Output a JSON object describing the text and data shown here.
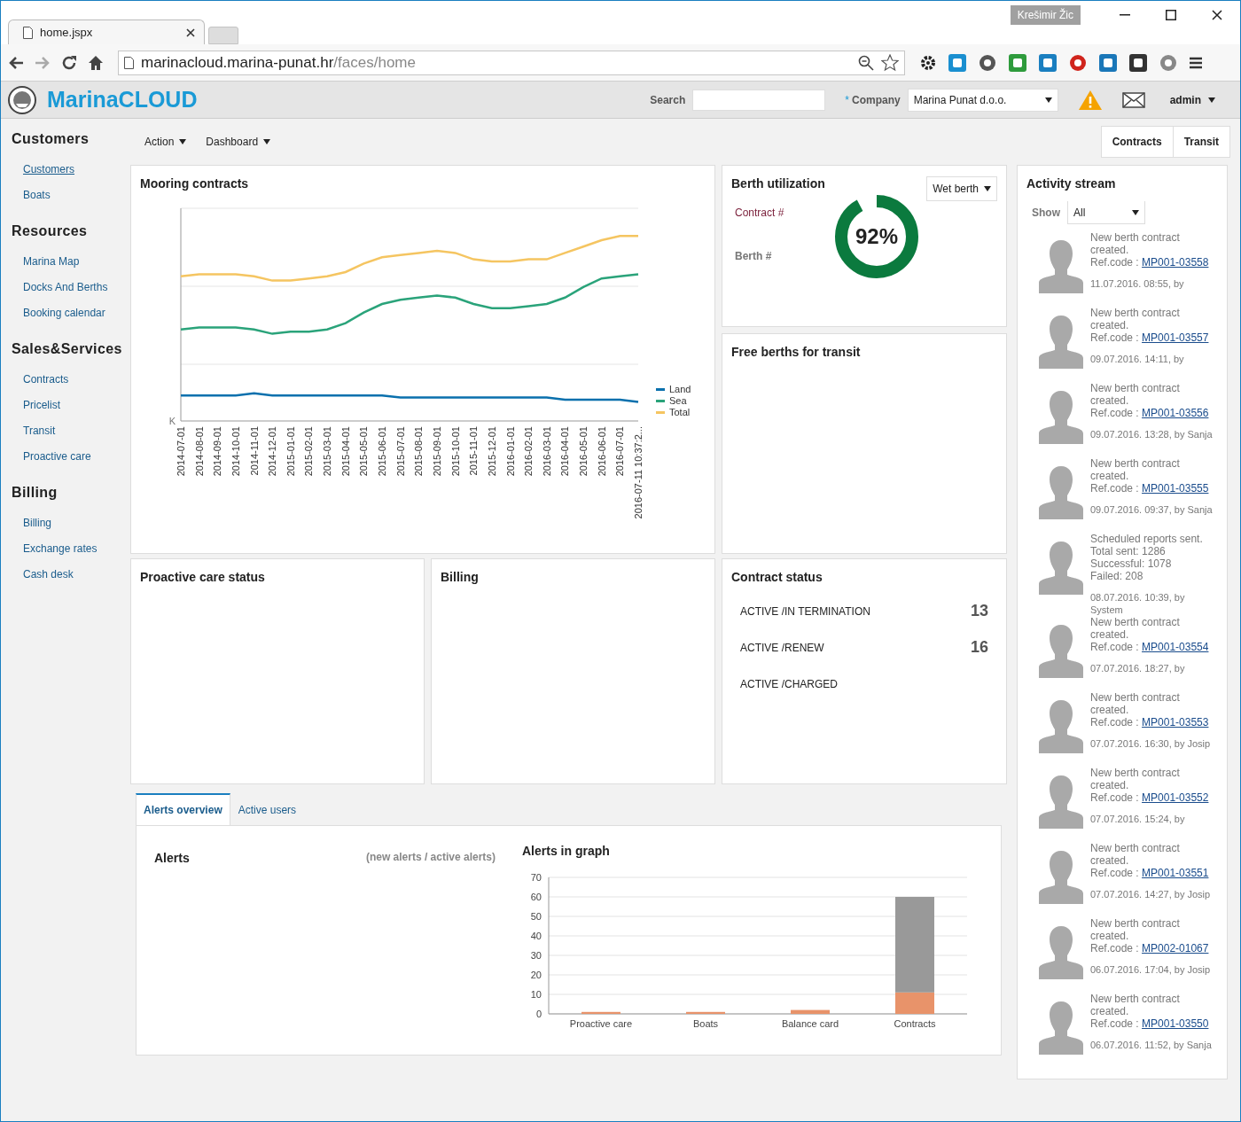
{
  "browser": {
    "tab_title": "home.jspx",
    "profile": "Krešimir Žic",
    "url_host": "marinacloud.marina-punat.hr",
    "url_path": "/faces/home"
  },
  "header": {
    "brand": "MarinaCLOUD",
    "search_label": "Search",
    "required_mark": "*",
    "company_label": "Company",
    "company_value": "Marina Punat d.o.o.",
    "user": "admin"
  },
  "toolbar": {
    "menus": [
      "Action",
      "Dashboard"
    ],
    "buttons": [
      "Contracts",
      "Transit"
    ]
  },
  "sidebar": [
    {
      "title": "Customers",
      "items": [
        {
          "label": "Customers",
          "selected": true
        },
        {
          "label": "Boats",
          "selected": false
        }
      ]
    },
    {
      "title": "Resources",
      "items": [
        {
          "label": "Marina Map",
          "selected": false
        },
        {
          "label": "Docks And Berths",
          "selected": false
        },
        {
          "label": "Booking calendar",
          "selected": false
        }
      ]
    },
    {
      "title": "Sales&Services",
      "items": [
        {
          "label": "Contracts",
          "selected": false
        },
        {
          "label": "Pricelist",
          "selected": false
        },
        {
          "label": "Transit",
          "selected": false
        },
        {
          "label": "Proactive care",
          "selected": false
        }
      ]
    },
    {
      "title": "Billing",
      "items": [
        {
          "label": "Billing",
          "selected": false
        },
        {
          "label": "Exchange rates",
          "selected": false
        },
        {
          "label": "Cash desk",
          "selected": false
        }
      ]
    }
  ],
  "mooring": {
    "title": "Mooring contracts",
    "y_tick": "K",
    "x_labels": [
      "2014-07-01",
      "2014-08-01",
      "2014-09-01",
      "2014-10-01",
      "2014-11-01",
      "2014-12-01",
      "2015-01-01",
      "2015-02-01",
      "2015-03-01",
      "2015-04-01",
      "2015-05-01",
      "2015-06-01",
      "2015-07-01",
      "2015-08-01",
      "2015-09-01",
      "2015-10-01",
      "2015-11-01",
      "2015-12-01",
      "2016-01-01",
      "2016-02-01",
      "2016-03-01",
      "2016-04-01",
      "2016-05-01",
      "2016-06-01",
      "2016-07-01",
      "2016-07-11 10:37:2..."
    ],
    "legend": [
      {
        "name": "Land",
        "color": "#0a70ad"
      },
      {
        "name": "Sea",
        "color": "#2aa37a"
      },
      {
        "name": "Total",
        "color": "#f5c561"
      }
    ]
  },
  "berth": {
    "title": "Berth utilization",
    "filter": "Wet berth",
    "contract_label": "Contract #",
    "berth_label": "Berth #",
    "level": 0.92,
    "reading": "92%"
  },
  "free_berths": {
    "title": "Free berths for transit"
  },
  "proactive": {
    "title": "Proactive care status"
  },
  "billing": {
    "title": "Billing"
  },
  "contract_status": {
    "title": "Contract status",
    "rows": [
      {
        "label": "ACTIVE /IN TERMINATION",
        "count": "13"
      },
      {
        "label": "ACTIVE /RENEW",
        "count": "16"
      },
      {
        "label": "ACTIVE /CHARGED"
      }
    ]
  },
  "tabs": [
    {
      "label": "Alerts overview",
      "selected": true
    },
    {
      "label": "Active users",
      "selected": false
    }
  ],
  "alerts": {
    "title": "Alerts",
    "hint": "(new alerts / active alerts)",
    "chart_data": {
      "type": "bar",
      "title": "Alerts in graph",
      "categories": [
        "Proactive care",
        "Boats",
        "Balance card",
        "Contracts"
      ],
      "stacked": true,
      "grid": true,
      "ylim": [
        0,
        70
      ],
      "yticks": [
        0,
        10,
        20,
        30,
        40,
        50,
        60,
        70
      ],
      "series": [
        {
          "color": "#e8936a",
          "values": [
            1,
            1,
            2,
            11
          ]
        },
        {
          "color": "#999999",
          "values": [
            0,
            0,
            0,
            49
          ]
        }
      ]
    }
  },
  "activity": {
    "title": "Activity stream",
    "show_label": "Show",
    "filter": "All",
    "items": [
      {
        "kind": "contract",
        "text": "New berth contract created.",
        "ref_label": "Ref.code :",
        "ref": "MP001-03558",
        "meta": "11.07.2016. 08:55, by"
      },
      {
        "kind": "contract",
        "text": "New berth contract created.",
        "ref_label": "Ref.code :",
        "ref": "MP001-03557",
        "meta": "09.07.2016. 14:11, by"
      },
      {
        "kind": "contract",
        "text": "New berth contract created.",
        "ref_label": "Ref.code :",
        "ref": "MP001-03556",
        "meta": "09.07.2016. 13:28, by Sanja"
      },
      {
        "kind": "contract",
        "text": "New berth contract created.",
        "ref_label": "Ref.code :",
        "ref": "MP001-03555",
        "meta": "09.07.2016. 09:37, by Sanja"
      },
      {
        "kind": "report",
        "lines": [
          "Scheduled reports sent.",
          "Total sent: 1286",
          "Successful: 1078",
          "Failed: 208"
        ],
        "meta": "08.07.2016. 10:39, by System"
      },
      {
        "kind": "contract",
        "text": "New berth contract created.",
        "ref_label": "Ref.code :",
        "ref": "MP001-03554",
        "meta": "07.07.2016. 18:27, by"
      },
      {
        "kind": "contract",
        "text": "New berth contract created.",
        "ref_label": "Ref.code :",
        "ref": "MP001-03553",
        "meta": "07.07.2016. 16:30, by Josip"
      },
      {
        "kind": "contract",
        "text": "New berth contract created.",
        "ref_label": "Ref.code :",
        "ref": "MP001-03552",
        "meta": "07.07.2016. 15:24, by"
      },
      {
        "kind": "contract",
        "text": "New berth contract created.",
        "ref_label": "Ref.code :",
        "ref": "MP001-03551",
        "meta": "07.07.2016. 14:27, by Josip"
      },
      {
        "kind": "contract",
        "text": "New berth contract created.",
        "ref_label": "Ref.code :",
        "ref": "MP002-01067",
        "meta": "06.07.2016. 17:04, by Josip"
      },
      {
        "kind": "contract",
        "text": "New berth contract created.",
        "ref_label": "Ref.code :",
        "ref": "MP001-03550",
        "meta": "06.07.2016. 11:52, by Sanja"
      }
    ]
  }
}
